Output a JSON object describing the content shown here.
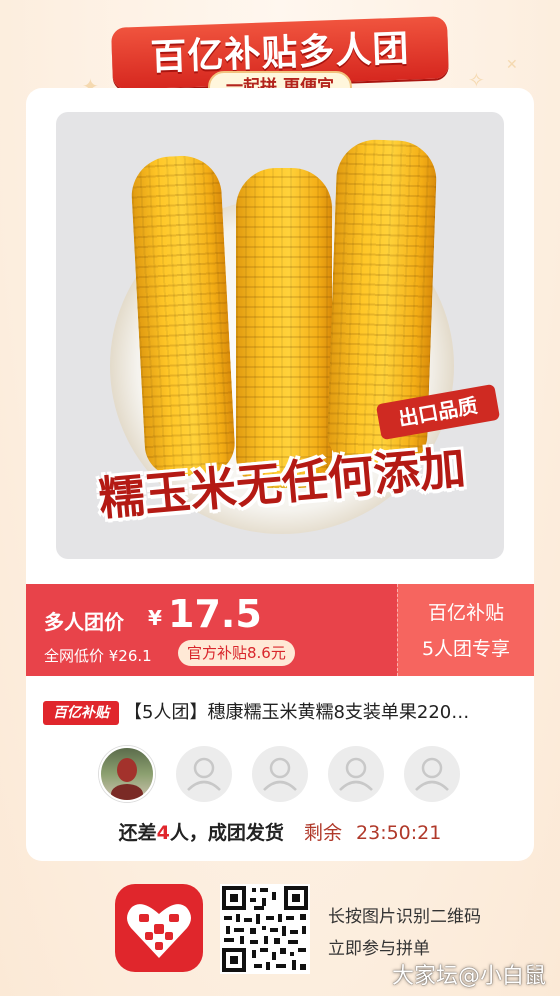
{
  "header": {
    "banner_title": "百亿补贴多人团",
    "banner_subtitle": "一起拼 更便宜"
  },
  "product_image": {
    "tag_export": "出口品质",
    "slogan": "糯玉米无任何添加"
  },
  "price_bar": {
    "label": "多人团价",
    "currency": "¥",
    "price": "17.5",
    "market_low": "全网低价 ¥26.1",
    "subsidy": "官方补贴8.6元",
    "right_line1": "百亿补贴",
    "right_line2": "5人团专享"
  },
  "product": {
    "badge": "百亿补贴",
    "title": "【5人团】穗康糯玉米黄糯8支装单果220…"
  },
  "group": {
    "missing_prefix": "还差",
    "missing_count": "4",
    "missing_suffix": "人，成团发货",
    "remaining_label": "剩余",
    "countdown": "23:50:21"
  },
  "footer": {
    "line1": "长按图片识别二维码",
    "line2": "立即参与拼单",
    "app_icon": "pinduoduo-icon"
  },
  "watermark": "大家坛@小白鼠",
  "colors": {
    "brand_red": "#e0262c",
    "price_bar": "#e8434a",
    "background": "#fdf0e2"
  }
}
